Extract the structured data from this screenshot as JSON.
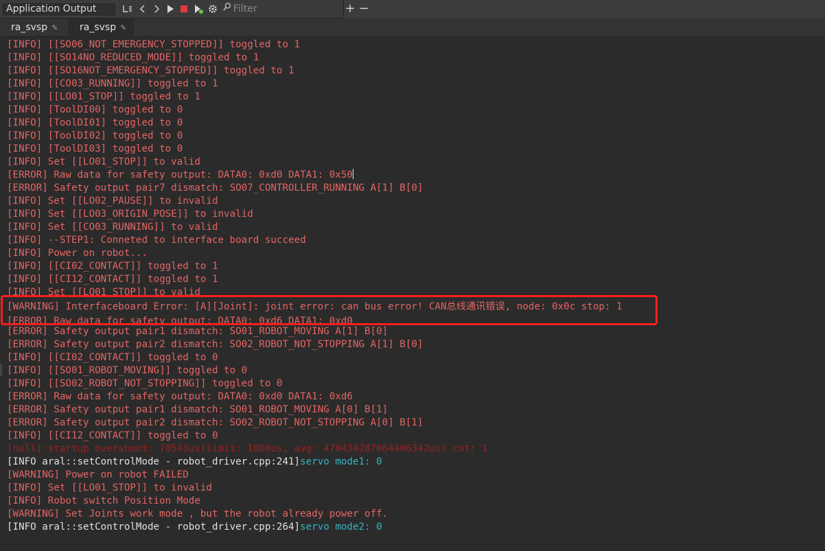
{
  "toolbar": {
    "title": "Application Output",
    "filter_placeholder": "Filter",
    "icons": [
      "text-wrap-icon",
      "back-icon",
      "forward-icon",
      "run-icon",
      "stop-icon",
      "attach-debugger-icon",
      "settings-icon",
      "filter-icon",
      "zoom-in-icon",
      "zoom-out-icon"
    ]
  },
  "tabs": [
    {
      "label": "ra_svsp",
      "active": false
    },
    {
      "label": "ra_svsp",
      "active": true
    }
  ],
  "colors": {
    "log_red": "#e56565",
    "log_white": "#e0e0e0",
    "log_teal": "#35b3c2",
    "highlight_border": "#ff1e1e"
  },
  "log_lines": [
    {
      "t": "[INFO] [[SO06_NOT_EMERGENCY_STOPPED]] toggled to 1"
    },
    {
      "t": "[INFO] [[SO14NO_REDUCED_MODE]] toggled to 1"
    },
    {
      "t": "[INFO] [[SO16NOT_EMERGENCY_STOPPED]] toggled to 1"
    },
    {
      "t": "[INFO] [[CO03_RUNNING]] toggled to 1"
    },
    {
      "t": "[INFO] [[LO01_STOP]] toggled to 1"
    },
    {
      "t": "[INFO] [ToolDI00] toggled to 0"
    },
    {
      "t": "[INFO] [ToolDI01] toggled to 0"
    },
    {
      "t": "[INFO] [ToolDI02] toggled to 0"
    },
    {
      "t": "[INFO] [ToolDI03] toggled to 0"
    },
    {
      "t": "[INFO] Set [[LO01_STOP]] to valid"
    },
    {
      "t": "[ERROR] Raw data for safety output: DATA0: 0xd0 DATA1: 0x50"
    },
    {
      "t": "[ERROR] Safety output pair7 dismatch: SO07_CONTROLLER_RUNNING A[1] B[0]"
    },
    {
      "t": "[INFO] Set [[LO02_PAUSE]] to invalid"
    },
    {
      "t": "[INFO] Set [[LO03_ORIGIN_POSE]] to invalid"
    },
    {
      "t": "[INFO] Set [[CO03_RUNNING]] to valid"
    },
    {
      "t": "[INFO] --STEP1: Conneted to interface board succeed"
    },
    {
      "t": "[INFO] Power on robot..."
    },
    {
      "t": "[INFO] [[CI02_CONTACT]] toggled to 1"
    },
    {
      "t": "[INFO] [[CI12_CONTACT]] toggled to 1"
    },
    {
      "t": "[INFO] Set [[LO01_STOP]] to valid"
    },
    {
      "t": "[WARNING] Interfaceboard Error: [A][Joint]: joint error: can bus error! CAN总线通讯错误, node: 0x0c stop: 1"
    },
    {
      "t": "[ERROR] Raw data for safety output: DATA0: 0xd6 DATA1: 0xd0"
    },
    {
      "t": "[ERROR] Safety output pair1 dismatch: SO01_ROBOT_MOVING A[1] B[0]"
    },
    {
      "t": "[ERROR] Safety output pair2 dismatch: SO02_ROBOT_NOT_STOPPING A[1] B[0]"
    },
    {
      "t": "[INFO] [[CI02_CONTACT]] toggled to 0"
    },
    {
      "t": "[INFO] [[SO01_ROBOT_MOVING]] toggled to 0"
    },
    {
      "t": "[INFO] [[SO02_ROBOT_NOT_STOPPING]] toggled to 0"
    },
    {
      "t": "[ERROR] Raw data for safety output: DATA0: 0xd0 DATA1: 0xd6"
    },
    {
      "t": "[ERROR] Safety output pair1 dismatch: SO01_ROBOT_MOVING A[0] B[1]"
    },
    {
      "t": "[ERROR] Safety output pair2 dismatch: SO02_ROBOT_NOT_STOPPING A[0] B[1]"
    },
    {
      "t": "[INFO] [[CI12_CONTACT]] toggled to 0"
    },
    {
      "t": "[null]:startup overshoot: 70543us(limit: 1000us, avg: 470434287064406342us) cnt: 1"
    },
    {
      "t": "[INFO aral::setControlMode - robot_driver.cpp:241]",
      "s": "servo mode1: 0"
    },
    {
      "t": "[WARNING] Power on robot FAILED"
    },
    {
      "t": "[INFO] Set [[LO01_STOP]] to invalid"
    },
    {
      "t": "[INFO] Robot switch Position Mode"
    },
    {
      "t": "[WARNING] Set Joints work mode , but the robot already power off."
    },
    {
      "t": "[INFO aral::setControlMode - robot_driver.cpp:264]",
      "s": "servo mode2: 0"
    }
  ]
}
